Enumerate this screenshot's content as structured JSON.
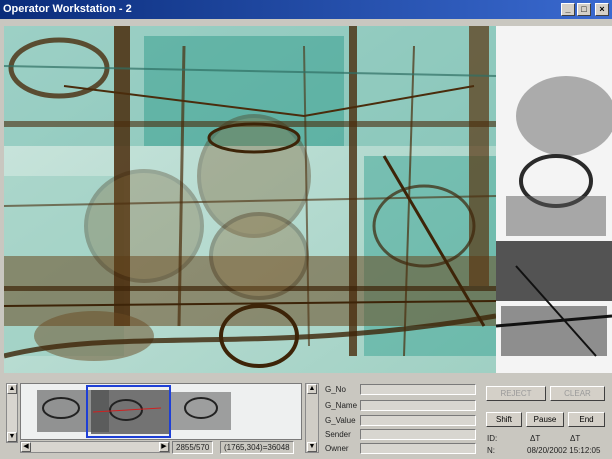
{
  "window": {
    "title": "Operator Workstation - 2"
  },
  "window_controls": {
    "minimize": "_",
    "maximize": "□",
    "close": "×"
  },
  "thumbnail_strip": {
    "readout_1": "2855/570",
    "readout_2": "(1765,304)=36048"
  },
  "fields": [
    {
      "label": "G_No"
    },
    {
      "label": "G_Name"
    },
    {
      "label": "G_Value"
    },
    {
      "label": "Sender"
    },
    {
      "label": "Owner"
    }
  ],
  "buttons": {
    "reject": "REJECT",
    "clear": "CLEAR",
    "shift": "Shift",
    "pause": "Pause",
    "end": "End"
  },
  "status": {
    "id_label": "ID:",
    "t1_label": "ΔT",
    "t2_label": "ΔT",
    "n_label": "N:",
    "datetime": "08/20/2002 15:12:05"
  },
  "colors": {
    "title_bar": "#0a2c7a",
    "scan_green": "#2f9c8c",
    "scan_brown": "#5a3410",
    "thumb_frame": "#1e3fd6"
  }
}
